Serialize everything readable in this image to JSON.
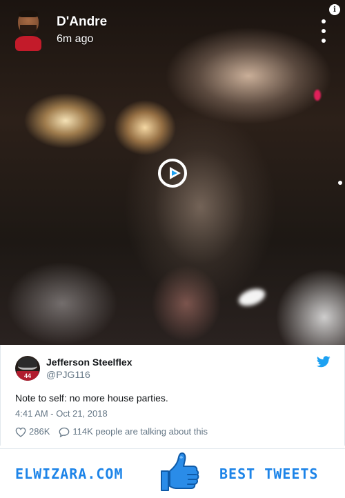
{
  "video": {
    "user_name": "D'Andre",
    "time_ago": "6m ago"
  },
  "tweet": {
    "name": "Jefferson Steelflex",
    "handle": "@PJG116",
    "text": "Note to self: no more house parties.",
    "timestamp": "4:41 AM - Oct 21, 2018",
    "likes": "286K",
    "talking": "114K people are talking about this",
    "avatar_jersey": "44"
  },
  "footer": {
    "left_text": "ELWIZARA.COM",
    "right_text": "BEST TWEETS"
  },
  "colors": {
    "twitter_blue": "#1da1f2",
    "brand_blue": "#1d84e8",
    "muted_text": "#657786",
    "body_text": "#14171a"
  }
}
